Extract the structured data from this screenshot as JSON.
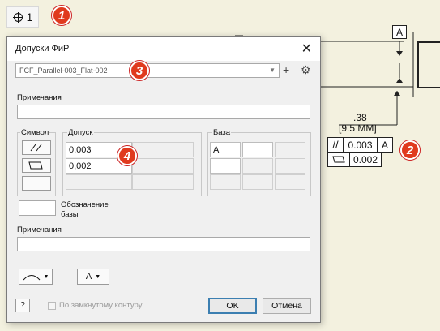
{
  "toolbar": {
    "fcf_tool_count": "1"
  },
  "callouts": [
    "1",
    "2",
    "3",
    "4"
  ],
  "drawing": {
    "datum_a": "A",
    "dimension_main": ".38",
    "dimension_alt": "[9.5 MM]",
    "fcf_row1_value": "0.003",
    "fcf_row1_datum": "A",
    "fcf_row2_value": "0.002"
  },
  "dialog": {
    "title": "Допуски ФиР",
    "close": "✕",
    "style_combo": "FCF_Parallel-003_Flat-002",
    "notes_top_label": "Примечания",
    "notes_top_value": "",
    "symbol_label": "Символ",
    "tolerance_label": "Допуск",
    "datum_label": "База",
    "tolerance_values": [
      "0,003",
      "0,002"
    ],
    "datum_values": [
      "A"
    ],
    "datum_identifier_label_line1": "Обозначение",
    "datum_identifier_label_line2": "базы",
    "datum_identifier_value": "",
    "notes_bottom_label": "Примечания",
    "notes_bottom_value": "",
    "datum_dropdown_value": "A",
    "closed_loop_label": "По замкнутому контуру",
    "ok_label": "OK",
    "cancel_label": "Отмена",
    "help_label": "?"
  },
  "colors": {
    "badge": "#e03a1e",
    "background": "#f3f1df",
    "primary_border": "#3c7fb1"
  }
}
